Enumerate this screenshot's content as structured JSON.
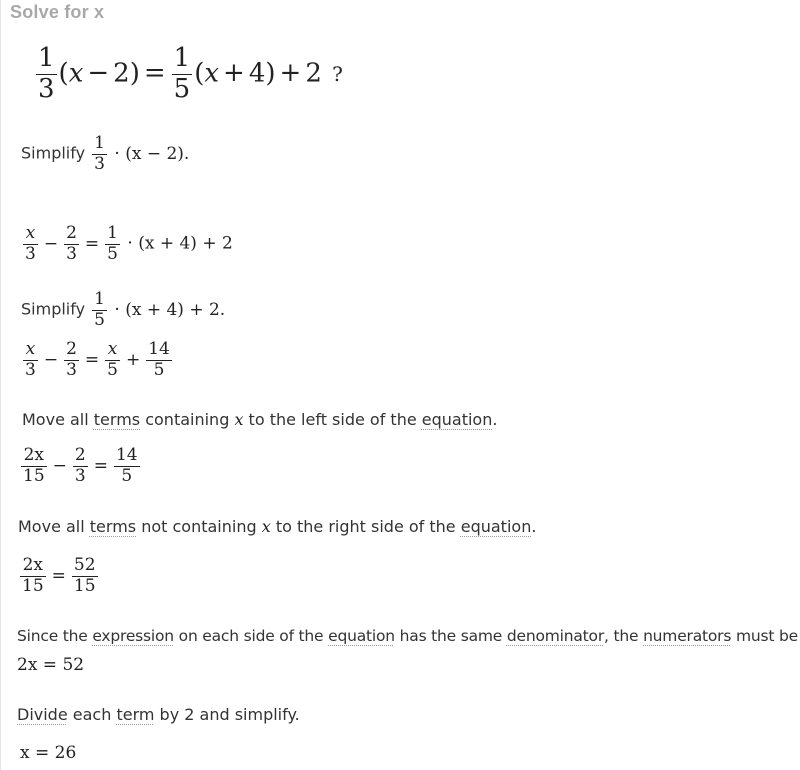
{
  "title": "Solve for x",
  "problem": {
    "f1_num": "1",
    "f1_den": "3",
    "p1": "(",
    "x": "x",
    "minus": "−",
    "two": "2",
    "p2": ")",
    "eq": "=",
    "f2_num": "1",
    "f2_den": "5",
    "p3": "(",
    "plus": "+",
    "four": "4",
    "p4": ")",
    "plus2": "+",
    "two2": "2",
    "qmark": "?"
  },
  "steps": [
    {
      "label": "Simplify",
      "expr": {
        "num": "1",
        "den": "3",
        "dot": "·",
        "rest": "(x − 2)."
      }
    },
    {
      "result": {
        "a_num": "x",
        "a_den": "3",
        "minus": "−",
        "b_num": "2",
        "b_den": "3",
        "eq": "=",
        "c_num": "1",
        "c_den": "5",
        "dot": "·",
        "rest": "(x + 4) + 2"
      }
    },
    {
      "label": "Simplify",
      "expr": {
        "num": "1",
        "den": "5",
        "dot": "·",
        "rest": "(x + 4) + 2."
      },
      "result": {
        "a_num": "x",
        "a_den": "3",
        "minus": "−",
        "b_num": "2",
        "b_den": "3",
        "eq": "=",
        "c_num": "x",
        "c_den": "5",
        "plus": "+",
        "d_num": "14",
        "d_den": "5"
      }
    },
    {
      "text": {
        "t1": "Move all ",
        "term": "terms",
        "t2": " containing ",
        "var": "x",
        "t3": " to the left side of the ",
        "term2": "equation",
        "t4": "."
      },
      "result": {
        "a_num": "2x",
        "a_den": "15",
        "minus": "−",
        "b_num": "2",
        "b_den": "3",
        "eq": "=",
        "c_num": "14",
        "c_den": "5"
      }
    },
    {
      "text": {
        "t1": "Move all ",
        "term": "terms",
        "t2": " not containing ",
        "var": "x",
        "t3": " to the right side of the ",
        "term2": "equation",
        "t4": "."
      },
      "result": {
        "a_num": "2x",
        "a_den": "15",
        "eq": "=",
        "b_num": "52",
        "b_den": "15"
      }
    },
    {
      "text": {
        "t1": "Since the ",
        "term1": "expression",
        "t2": " on each side of the ",
        "term2": "equation",
        "t3": " has the same ",
        "term3": "denominator",
        "t4": ", the ",
        "term4": "numerators",
        "t5": " must be equal."
      },
      "result": "2x = 52"
    },
    {
      "text": {
        "term1": "Divide",
        "t1": " each ",
        "term2": "term",
        "t2": " by 2 and simplify."
      },
      "result": "x = 26"
    }
  ]
}
